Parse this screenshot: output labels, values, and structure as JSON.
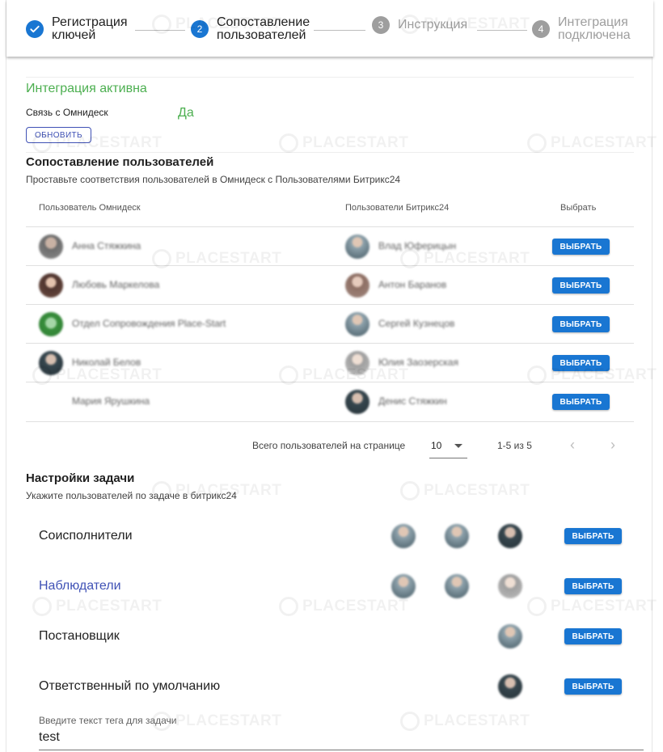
{
  "stepper": {
    "steps": [
      {
        "number": "",
        "label": "Регистрация\nключей",
        "state": "done"
      },
      {
        "number": "2",
        "label": "Сопоставление\nпользователей",
        "state": "active"
      },
      {
        "number": "3",
        "label": "Инструкция",
        "state": "idle"
      },
      {
        "number": "4",
        "label": "Интеграция\nподключена",
        "state": "idle"
      }
    ],
    "check_icon": "check-icon"
  },
  "status": {
    "title": "Интеграция активна",
    "link_label": "Связь с Омнидеск",
    "link_value": "Да",
    "refresh_label": "обновить"
  },
  "mapping": {
    "title": "Сопоставление пользователей",
    "subtitle": "Проставьте соответствия пользователей в Омнидеск с Пользователями Битрикс24",
    "columns": [
      "Пользователь Омнидеск",
      "Пользователи Битрикс24",
      "Выбрать"
    ],
    "rows": [
      {
        "omni_name": "Анна Стяжкина",
        "bitrix_name": "Влад Юферицын",
        "button": "ВЫБРАТЬ"
      },
      {
        "omni_name": "Любовь Маркелова",
        "bitrix_name": "Антон Баранов",
        "button": "ВЫБРАТЬ"
      },
      {
        "omni_name": "Отдел Сопровождения Place-Start",
        "bitrix_name": "Сергей Кузнецов",
        "button": "ВЫБРАТЬ"
      },
      {
        "omni_name": "Николай Белов",
        "bitrix_name": "Юлия Заозерская",
        "button": "ВЫБРАТЬ"
      },
      {
        "omni_name": "Мария Ярушкина",
        "bitrix_name": "Денис Стяжкин",
        "button": "ВЫБРАТЬ"
      }
    ],
    "pagination": {
      "rows_per_page_label": "Всего пользователей на странице",
      "rows_per_page_value": "10",
      "range": "1-5 из 5",
      "prev_icon": "chevron-left-icon",
      "next_icon": "chevron-right-icon"
    }
  },
  "task": {
    "title": "Настройки задачи",
    "subtitle": "Укажите пользователей по задаче в битрикс24",
    "rows": [
      {
        "label": "Соисполнители",
        "button": "ВЫБРАТЬ"
      },
      {
        "label": "Наблюдатели",
        "button": "ВЫБРАТЬ"
      },
      {
        "label": "Постановщик",
        "button": "ВЫБРАТЬ"
      },
      {
        "label": "Ответственный по умолчанию",
        "button": "ВЫБРАТЬ"
      }
    ],
    "tag_field_label": "Введите текст тега для задачи",
    "tag_field_value": "test"
  },
  "watermark": "PLACESTART",
  "colors": {
    "primary": "#1976d2",
    "success": "#4caf50",
    "indigo": "#3f51b5",
    "idle": "#9e9e9e"
  }
}
